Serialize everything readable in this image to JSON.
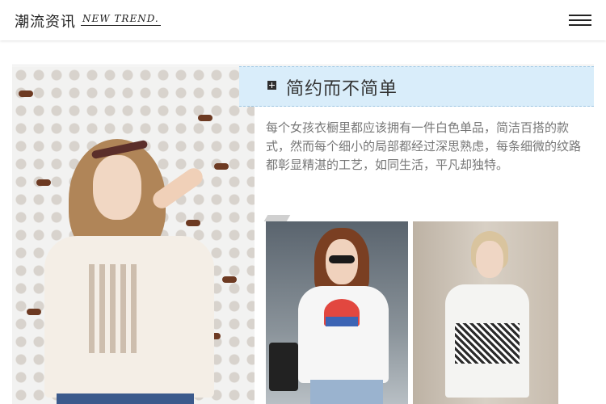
{
  "header": {
    "brand_cn": "潮流资讯",
    "brand_en": "NEW TREND.",
    "menu_icon": "hamburger-menu-icon"
  },
  "feature": {
    "title": "简约而不简单",
    "body": "每个女孩衣橱里都应该拥有一件白色单品，简洁百搭的款式，然而每个细小的局部都经过深思熟虑，每条细微的纹路都彰显精湛的工艺，如同生活，平凡却独特。",
    "title_bar_color": "#d9edfa"
  },
  "images": {
    "left": "photo-woman-white-tee-jeans",
    "thumb_a": "photo-woman-sunglasses-white-tee",
    "thumb_b": "photo-woman-white-tee-print"
  }
}
